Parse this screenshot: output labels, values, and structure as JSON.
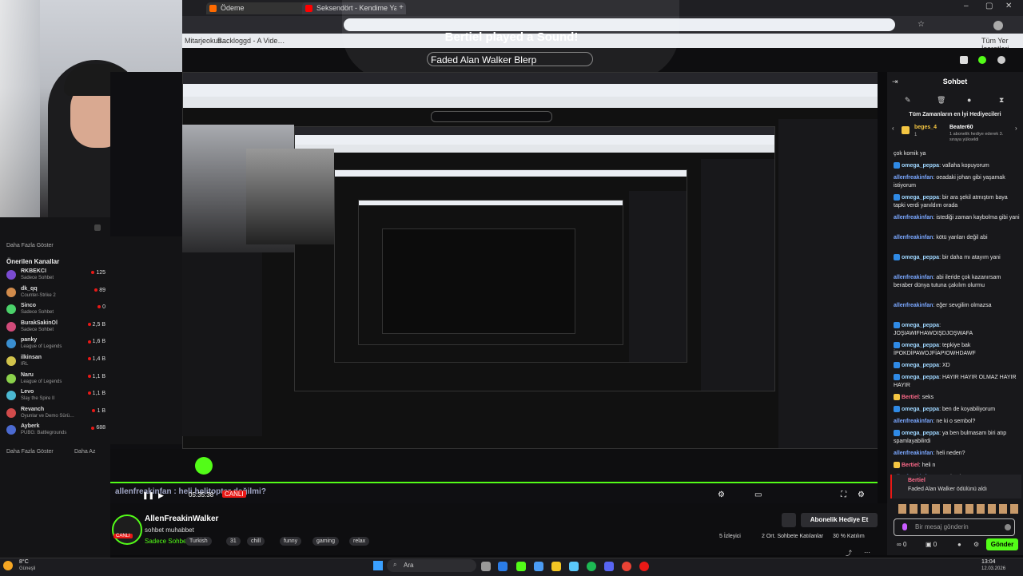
{
  "browser": {
    "tabs": [
      "Ödeme",
      "Seksendört - Kendime Yala…"
    ],
    "bookmarks": [
      "Mitarjeokus…",
      "Backloggd - A Vide…"
    ],
    "bookmarks_right": "Tüm Yer İşaretleri"
  },
  "alert": {
    "title": "Bertiel played a Sound!",
    "sound": "Faded Alan Walker Blerp"
  },
  "sidebar": {
    "show_more_top": "Daha Fazla Göster",
    "recommended_title": "Önerilen Kanallar",
    "channels": [
      {
        "name": "RKBEKCI",
        "game": "Sadece Sohbet",
        "viewers": "125"
      },
      {
        "name": "dk_qq",
        "game": "Counter-Strike 2",
        "viewers": "89"
      },
      {
        "name": "Sinco",
        "game": "Sadece Sohbet",
        "viewers": "0"
      },
      {
        "name": "BurakSakinOl",
        "game": "Sadece Sohbet",
        "viewers": "2,5 B"
      },
      {
        "name": "panky",
        "game": "League of Legends",
        "viewers": "1,6 B"
      },
      {
        "name": "ilkinsan",
        "game": "IRL",
        "viewers": "1,4 B"
      },
      {
        "name": "Naru",
        "game": "League of Legends",
        "viewers": "1,1 B"
      },
      {
        "name": "Levo",
        "game": "Slay the Spire II",
        "viewers": "1,1 B"
      },
      {
        "name": "Revanch",
        "game": "Oyunlar ve Demo Sürü…",
        "viewers": "1 B"
      },
      {
        "name": "Ayberk",
        "game": "PUBG: Battlegrounds",
        "viewers": "688"
      }
    ],
    "show_more": "Daha Fazla Göster",
    "show_less": "Daha Az"
  },
  "stream_overlay": {
    "caption": "allenfreakinfan : heli helitopter değilmi?",
    "time": "05:35:38",
    "live": "CANLI"
  },
  "channel": {
    "name": "AllenFreakinWalker",
    "title": "sohbet muhabbet",
    "category": "Sadece Sohbet",
    "tags": [
      "Turkish",
      "31",
      "chill",
      "funny",
      "gaming",
      "relax"
    ],
    "subscribe_label": "Abonelik Hediye Et",
    "viewers": "5 İzleyici",
    "ratio": "2 Ort. Sohbete Katılanlar",
    "percent": "30 % Katılım",
    "live_badge": "CANLI"
  },
  "chat": {
    "header": "Sohbet",
    "top_gifters_title": "Tüm Zamanların en İyi Hediyecileri",
    "gifter1": "beges_4",
    "gifter1_rank": "1",
    "gifter2": "Beater60",
    "gifter2_note": "1 abonelik hediye ederek 3. sıraya yükseldi",
    "messages": [
      {
        "user": "",
        "text": "çok komik ya"
      },
      {
        "user": "omega_peppa",
        "text": "vallaha kopuyorum"
      },
      {
        "user": "allenfreakinfan",
        "text": "oeadaki johan gibi yaşamak istiyorum"
      },
      {
        "user": "omega_peppa",
        "text": "bir ara şekil atmıştım baya tapki verdi yanıldım orada"
      },
      {
        "user": "allenfreakinfan",
        "text": "istediği zaman kaybolma gibi yani"
      },
      {
        "user": "allenfreakinfan",
        "text": "kötü yanları değil abi"
      },
      {
        "user": "omega_peppa",
        "text": "bir daha mı atayım yani"
      },
      {
        "user": "allenfreakinfan",
        "text": "abi ileride çok kazanırsam beraber dünya tutuna çakılım olurmu"
      },
      {
        "user": "allenfreakinfan",
        "text": "eğer sevgilim olmazsa"
      },
      {
        "user": "omega_peppa",
        "text": "JOŞIAWIFHAWOIŞDJOŞWAFA"
      },
      {
        "user": "omega_peppa",
        "text": "tepkiye bak İPOKDİPAWOJFİAPIOWHDAWF"
      },
      {
        "user": "omega_peppa",
        "text": "XD"
      },
      {
        "user": "omega_peppa",
        "text": "HAYIR HAYIR OLMAZ HAYIR HAYIR"
      },
      {
        "user": "Bertiel",
        "text": "seks"
      },
      {
        "user": "omega_peppa",
        "text": "ben de koyabiliyorum"
      },
      {
        "user": "allenfreakinfan",
        "text": "ne ki o sembol?"
      },
      {
        "user": "omega_peppa",
        "text": "ya ben bulmasam biri atıp spamlayabilirdi"
      },
      {
        "user": "allenfreakinfan",
        "text": "heli neden?"
      },
      {
        "user": "Bertiel",
        "text": "heli n"
      },
      {
        "user": "allenfreakinfan",
        "text": "o ne demk?"
      },
      {
        "user": "allenfreakinfan",
        "text": "heli helitopter değilmi?"
      }
    ],
    "redeem_user": "Bertiel",
    "redeem_text": "Faded Alan Walker ödülünü aldı",
    "input_placeholder": "Bir mesaj gönderin",
    "points": "0",
    "points2": "0",
    "send_label": "Gönder"
  },
  "taskbar": {
    "weather_temp": "8°C",
    "weather_label": "Güneşli",
    "search_placeholder": "Ara",
    "time": "13:04",
    "date": "12.03.2026"
  },
  "colors": {
    "accent": "#53fc18",
    "live": "#e91916",
    "chat_bg": "#18181b"
  }
}
